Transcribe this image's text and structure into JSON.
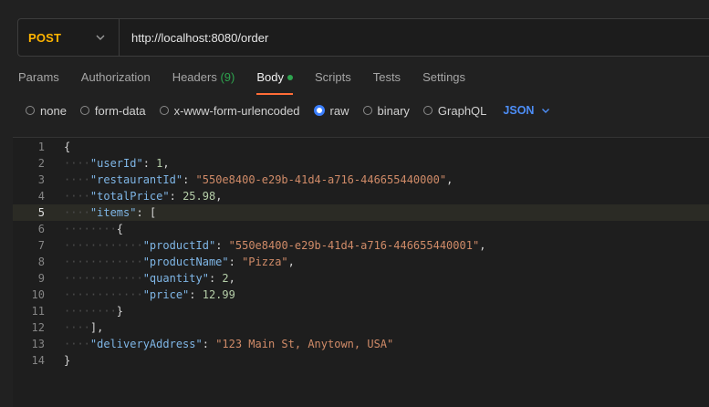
{
  "request": {
    "method": "POST",
    "url": "http://localhost:8080/order"
  },
  "tabs": [
    {
      "label": "Params"
    },
    {
      "label": "Authorization"
    },
    {
      "label": "Headers",
      "count": "(9)"
    },
    {
      "label": "Body",
      "active": true
    },
    {
      "label": "Scripts"
    },
    {
      "label": "Tests"
    },
    {
      "label": "Settings"
    }
  ],
  "body_types": [
    {
      "label": "none"
    },
    {
      "label": "form-data"
    },
    {
      "label": "x-www-form-urlencoded"
    },
    {
      "label": "raw",
      "selected": true
    },
    {
      "label": "binary"
    },
    {
      "label": "GraphQL"
    }
  ],
  "format": "JSON",
  "editor": {
    "current_line": 5,
    "lines": [
      {
        "n": "1",
        "tokens": [
          [
            "br",
            "{"
          ]
        ]
      },
      {
        "n": "2",
        "tokens": [
          [
            "ws",
            "····"
          ],
          [
            "k",
            "\"userId\""
          ],
          [
            "p",
            ": "
          ],
          [
            "n",
            "1"
          ],
          [
            "p",
            ","
          ]
        ]
      },
      {
        "n": "3",
        "tokens": [
          [
            "ws",
            "····"
          ],
          [
            "k",
            "\"restaurantId\""
          ],
          [
            "p",
            ": "
          ],
          [
            "s",
            "\"550e8400-e29b-41d4-a716-446655440000\""
          ],
          [
            "p",
            ","
          ]
        ]
      },
      {
        "n": "4",
        "tokens": [
          [
            "ws",
            "····"
          ],
          [
            "k",
            "\"totalPrice\""
          ],
          [
            "p",
            ": "
          ],
          [
            "n",
            "25.98"
          ],
          [
            "p",
            ","
          ]
        ]
      },
      {
        "n": "5",
        "tokens": [
          [
            "ws",
            "····"
          ],
          [
            "k",
            "\"items\""
          ],
          [
            "p",
            ": "
          ],
          [
            "br",
            "["
          ]
        ]
      },
      {
        "n": "6",
        "tokens": [
          [
            "ws",
            "········"
          ],
          [
            "br",
            "{"
          ]
        ]
      },
      {
        "n": "7",
        "tokens": [
          [
            "ws",
            "············"
          ],
          [
            "k",
            "\"productId\""
          ],
          [
            "p",
            ": "
          ],
          [
            "s",
            "\"550e8400-e29b-41d4-a716-446655440001\""
          ],
          [
            "p",
            ","
          ]
        ]
      },
      {
        "n": "8",
        "tokens": [
          [
            "ws",
            "············"
          ],
          [
            "k",
            "\"productName\""
          ],
          [
            "p",
            ": "
          ],
          [
            "s",
            "\"Pizza\""
          ],
          [
            "p",
            ","
          ]
        ]
      },
      {
        "n": "9",
        "tokens": [
          [
            "ws",
            "············"
          ],
          [
            "k",
            "\"quantity\""
          ],
          [
            "p",
            ": "
          ],
          [
            "n",
            "2"
          ],
          [
            "p",
            ","
          ]
        ]
      },
      {
        "n": "10",
        "tokens": [
          [
            "ws",
            "············"
          ],
          [
            "k",
            "\"price\""
          ],
          [
            "p",
            ": "
          ],
          [
            "n",
            "12.99"
          ]
        ]
      },
      {
        "n": "11",
        "tokens": [
          [
            "ws",
            "········"
          ],
          [
            "br",
            "}"
          ]
        ]
      },
      {
        "n": "12",
        "tokens": [
          [
            "ws",
            "····"
          ],
          [
            "br",
            "]"
          ],
          [
            "p",
            ","
          ]
        ]
      },
      {
        "n": "13",
        "tokens": [
          [
            "ws",
            "····"
          ],
          [
            "k",
            "\"deliveryAddress\""
          ],
          [
            "p",
            ": "
          ],
          [
            "s",
            "\"123 Main St, Anytown, USA\""
          ]
        ]
      },
      {
        "n": "14",
        "tokens": [
          [
            "br",
            "}"
          ]
        ]
      }
    ]
  }
}
